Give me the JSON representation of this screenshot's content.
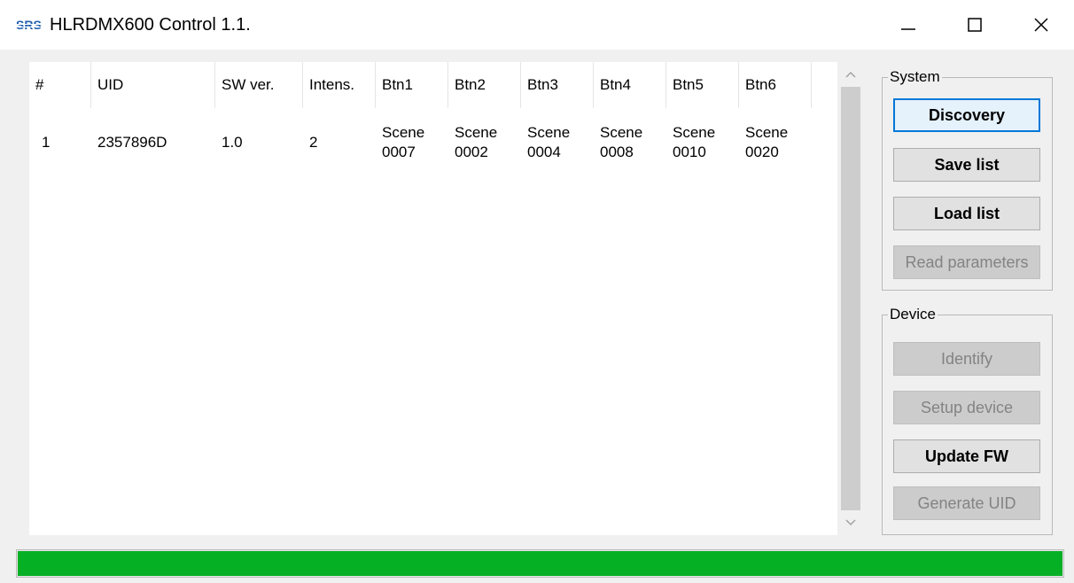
{
  "window": {
    "title": "HLRDMX600 Control 1.1.",
    "icon": "srs-logo-icon",
    "controls": {
      "minimize": "minimize-icon",
      "maximize": "maximize-icon",
      "close": "close-icon"
    }
  },
  "table": {
    "columns": [
      "#",
      "UID",
      "SW ver.",
      "Intens.",
      "Btn1",
      "Btn2",
      "Btn3",
      "Btn4",
      "Btn5",
      "Btn6"
    ],
    "rows": [
      {
        "num": "1",
        "uid": "2357896D",
        "sw": "1.0",
        "intens": "2",
        "btns": [
          [
            "Scene",
            "0007"
          ],
          [
            "Scene",
            "0002"
          ],
          [
            "Scene",
            "0004"
          ],
          [
            "Scene",
            "0008"
          ],
          [
            "Scene",
            "0010"
          ],
          [
            "Scene",
            "0020"
          ]
        ]
      }
    ]
  },
  "system": {
    "label": "System",
    "discovery": "Discovery",
    "save_list": "Save list",
    "load_list": "Load list",
    "read_parameters": "Read parameters"
  },
  "device": {
    "label": "Device",
    "identify": "Identify",
    "setup_device": "Setup device",
    "update_fw": "Update FW",
    "generate_uid": "Generate UID"
  },
  "progress": {
    "value": 100
  },
  "colors": {
    "progress_fill": "#06b025",
    "focus_border": "#0078d7",
    "logo_blue": "#1f5fae"
  }
}
